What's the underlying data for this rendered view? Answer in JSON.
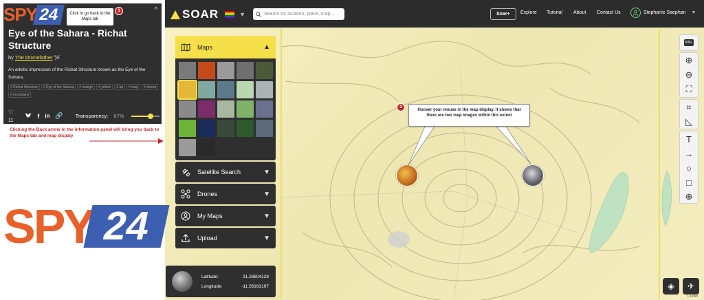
{
  "brand": {
    "logo_text": "SOAR",
    "spy_prefix": "SPY",
    "spy_number": "24"
  },
  "navbar": {
    "search_placeholder": "Search for location, place, map...",
    "soar_plus": "Soar+",
    "links": [
      "Explore",
      "Tutorial",
      "About",
      "Contact Us"
    ],
    "user_name": "Stephanie Saephan"
  },
  "info_panel": {
    "back_tooltip": "Click to go back to the Maps tab",
    "step_badge": "1",
    "title": "Eye of the Sahara - Richat Structure",
    "by_label": "by",
    "author": "The Dronefather",
    "description": "An artistic impression of the Richat Structure known as the Eye of the Sahara.",
    "tags": [
      "# Richat Structure",
      "# Eye of the Sahara",
      "# orange",
      "# yellow",
      "# art",
      "# map",
      "# desert",
      "# mountains"
    ],
    "likes": "11",
    "transparency_label": "Transparency:",
    "transparency_value": "67%",
    "transparency_level": 0.67
  },
  "annotation": {
    "text": "Clicking the Back arrow in the information panel will bring you back to the Maps tab and map dispaly"
  },
  "sidebar": {
    "maps_label": "Maps",
    "items": [
      "Satellite Search",
      "Drones",
      "My Maps",
      "Upload"
    ]
  },
  "thumbnails": [
    "#7a7a7a",
    "#c44a1a",
    "#9a9a9a",
    "#6f6f6f",
    "#4c5a3a",
    "#e4b73a",
    "#7fa8a0",
    "#5c7a8a",
    "#b9d8b0",
    "#aab3b6",
    "#8a8a8a",
    "#7a2d6a",
    "#a8b8a0",
    "#7fb36a",
    "#6a7090",
    "#6fb33a",
    "#1a2a5a",
    "#3a4a3a",
    "#2d5a2d",
    "#5a6a7a",
    "#9a9a9a",
    "#2a2a2a"
  ],
  "callout": {
    "badge": "2",
    "text": "Hoover your mouse in the map display. It shows that there are two map images within this extent"
  },
  "coordinates": {
    "latitude_label": "Latitude:",
    "latitude_value": "21.28604128",
    "longitude_label": "Longitude:",
    "longitude_value": "-11.56163197"
  },
  "map_controls": {
    "kml_label": "KML",
    "attribution": "Leaflet"
  },
  "colors": {
    "accent": "#f5e04a",
    "panel": "#2f2f2f",
    "annotation": "#c62828"
  }
}
